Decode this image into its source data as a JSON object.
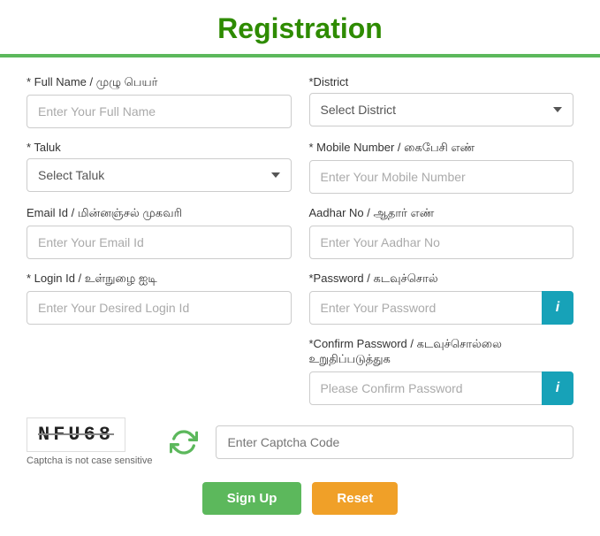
{
  "header": {
    "title": "Registration"
  },
  "form": {
    "full_name": {
      "label": "* Full Name / முழு பெயர்",
      "placeholder": "Enter Your Full Name"
    },
    "district": {
      "label": "*District",
      "placeholder": "Select District",
      "options": [
        "Select District"
      ]
    },
    "taluk": {
      "label": "* Taluk",
      "placeholder": "Select Taluk",
      "options": [
        "Select Taluk"
      ]
    },
    "mobile": {
      "label": "* Mobile Number / கைபேசி எண்",
      "placeholder": "Enter Your Mobile Number"
    },
    "email": {
      "label": "Email Id / மின்னஞ்சல் முகவரி",
      "placeholder": "Enter Your Email Id"
    },
    "aadhar": {
      "label": "Aadhar No / ஆதார் எண்",
      "placeholder": "Enter Your Aadhar No"
    },
    "login_id": {
      "label": "* Login Id / உள்நுழை ஐடி",
      "placeholder": "Enter Your Desired Login Id"
    },
    "password": {
      "label": "*Password / கடவுச்சொல்",
      "placeholder": "Enter Your Password"
    },
    "confirm_password": {
      "label": "*Confirm Password / கடவுச்சொல்லை உறுதிப்படுத்துக",
      "placeholder": "Please Confirm Password"
    },
    "captcha": {
      "code": "NFU68",
      "hint": "Captcha is not case sensitive",
      "input_placeholder": "Enter Captcha Code"
    },
    "buttons": {
      "signup": "Sign Up",
      "reset": "Reset"
    }
  }
}
